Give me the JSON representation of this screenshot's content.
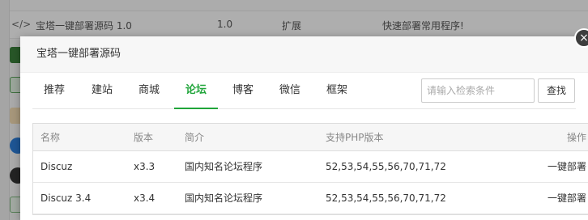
{
  "background": {
    "row": {
      "name": "宝塔一键部署源码 1.0",
      "version": "1.0",
      "type": "扩展",
      "desc": "快速部署常用程序!"
    }
  },
  "dialog": {
    "title": "宝塔一键部署源码",
    "close_glyph": "×",
    "tabs": [
      "推荐",
      "建站",
      "商城",
      "论坛",
      "博客",
      "微信",
      "框架"
    ],
    "active_tab": "论坛",
    "search": {
      "placeholder": "请输入检索条件",
      "button": "查找"
    },
    "table": {
      "headers": [
        "名称",
        "版本",
        "简介",
        "支持PHP版本",
        "操作"
      ],
      "rows": [
        {
          "name": "Discuz",
          "version": "x3.3",
          "desc": "国内知名论坛程序",
          "php": "52,53,54,55,56,70,71,72",
          "action": "一键部署"
        },
        {
          "name": "Discuz 3.4",
          "version": "x3.4",
          "desc": "国内知名论坛程序",
          "php": "52,53,54,55,56,70,71,72",
          "action": "一键部署"
        }
      ]
    }
  },
  "colors": {
    "accent": "#20a53a"
  }
}
